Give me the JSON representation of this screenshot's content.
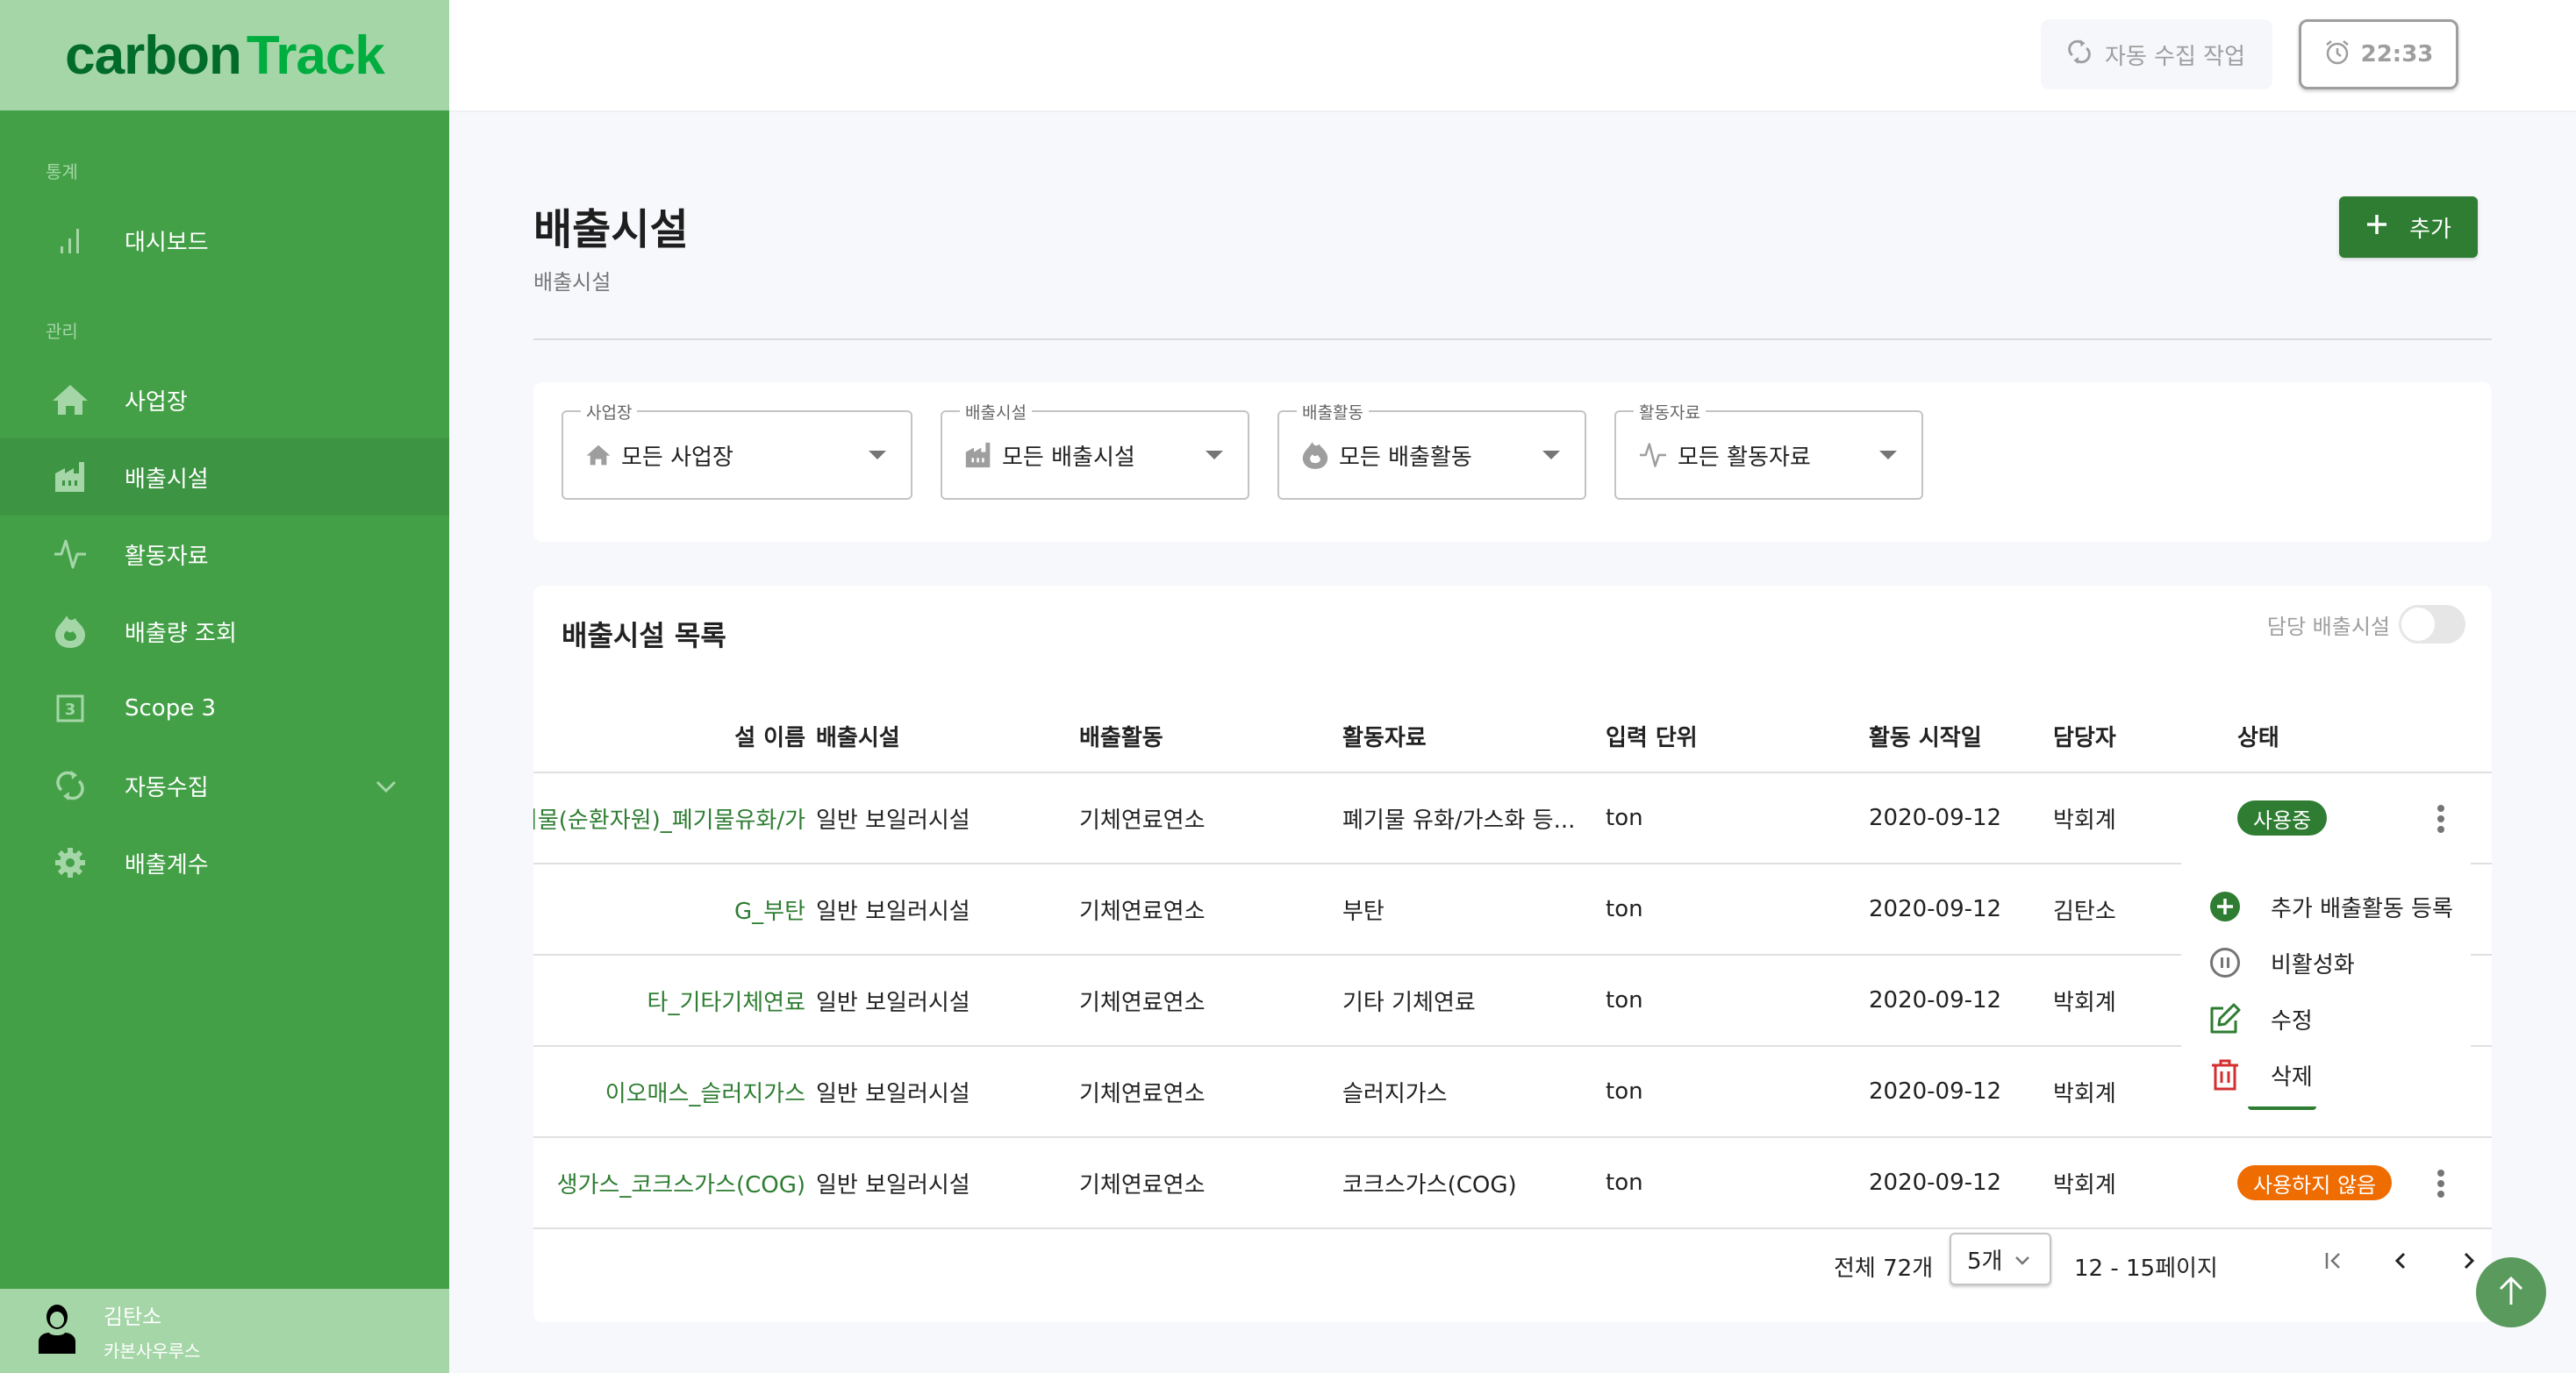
{
  "app": {
    "logo_part1": "carbon",
    "logo_part2": "Track"
  },
  "sidebar": {
    "sections": [
      {
        "label": "통계"
      },
      {
        "label": "관리"
      }
    ],
    "items": [
      {
        "label": "대시보드",
        "icon": "bar-chart-icon"
      },
      {
        "label": "사업장",
        "icon": "home-icon"
      },
      {
        "label": "배출시설",
        "icon": "factory-icon",
        "active": true
      },
      {
        "label": "활동자료",
        "icon": "pulse-icon"
      },
      {
        "label": "배출량 조회",
        "icon": "fire-icon"
      },
      {
        "label": "Scope 3",
        "icon": "scope3-icon"
      },
      {
        "label": "자동수집",
        "icon": "sync-icon",
        "expandable": true
      },
      {
        "label": "배출계수",
        "icon": "gear-icon"
      }
    ],
    "user": {
      "name": "김탄소",
      "org": "카본사우루스"
    }
  },
  "topbar": {
    "auto_collect_label": "자동 수집 작업",
    "timer_value": "22:33"
  },
  "page": {
    "title": "배출시설",
    "breadcrumb": "배출시설",
    "add_button_label": "추가"
  },
  "filters": [
    {
      "label": "사업장",
      "value": "모든 사업장",
      "icon": "home-icon"
    },
    {
      "label": "배출시설",
      "value": "모든 배출시설",
      "icon": "factory-icon"
    },
    {
      "label": "배출활동",
      "value": "모든 배출활동",
      "icon": "fire-icon"
    },
    {
      "label": "활동자료",
      "value": "모든 활동자료",
      "icon": "pulse-icon"
    }
  ],
  "table": {
    "title": "배출시설 목록",
    "toggle_label": "담당 배출시설",
    "toggle_on": false,
    "columns": [
      "설 이름",
      "배출시설",
      "배출활동",
      "활동자료",
      "입력 단위",
      "활동 시작일",
      "담당자",
      "상태"
    ],
    "rows": [
      {
        "name": "기물(순환자원)_폐기물유화/가",
        "facility": "일반 보일러시설",
        "activity": "기체연료연소",
        "data": "폐기물 유화/가스화 등...",
        "unit": "ton",
        "start": "2020-09-12",
        "owner": "박회계",
        "status": "사용중",
        "status_color": "#2e7d32"
      },
      {
        "name": "G_부탄",
        "facility": "일반 보일러시설",
        "activity": "기체연료연소",
        "data": "부탄",
        "unit": "ton",
        "start": "2020-09-12",
        "owner": "김탄소",
        "status": "",
        "status_color": ""
      },
      {
        "name": "타_기타기체연료",
        "facility": "일반 보일러시설",
        "activity": "기체연료연소",
        "data": "기타 기체연료",
        "unit": "ton",
        "start": "2020-09-12",
        "owner": "박회계",
        "status": "",
        "status_color": ""
      },
      {
        "name": "이오매스_슬러지가스",
        "facility": "일반 보일러시설",
        "activity": "기체연료연소",
        "data": "슬러지가스",
        "unit": "ton",
        "start": "2020-09-12",
        "owner": "박회계",
        "status": "",
        "status_color": ""
      },
      {
        "name": "생가스_코크스가스(COG)",
        "facility": "일반 보일러시설",
        "activity": "기체연료연소",
        "data": "코크스가스(COG)",
        "unit": "ton",
        "start": "2020-09-12",
        "owner": "박회계",
        "status": "사용하지 않음",
        "status_color": "#ef6c00"
      }
    ]
  },
  "context_menu": {
    "items": [
      {
        "label": "추가 배출활동 등록",
        "icon": "add-circle-icon",
        "color": "#2e7d32"
      },
      {
        "label": "비활성화",
        "icon": "pause-circle-icon",
        "color": "#757575"
      },
      {
        "label": "수정",
        "icon": "edit-icon",
        "color": "#2e7d32"
      },
      {
        "label": "삭제",
        "icon": "trash-icon",
        "color": "#d32f2f"
      }
    ]
  },
  "pagination": {
    "total": "전체 72개",
    "per_page": "5개",
    "range": "12 - 15페이지"
  },
  "colors": {
    "sidebar": "#43a047",
    "sidebar_light": "#a5d6a7",
    "primary": "#2e7d32",
    "warning": "#ef6c00",
    "danger": "#d32f2f"
  }
}
